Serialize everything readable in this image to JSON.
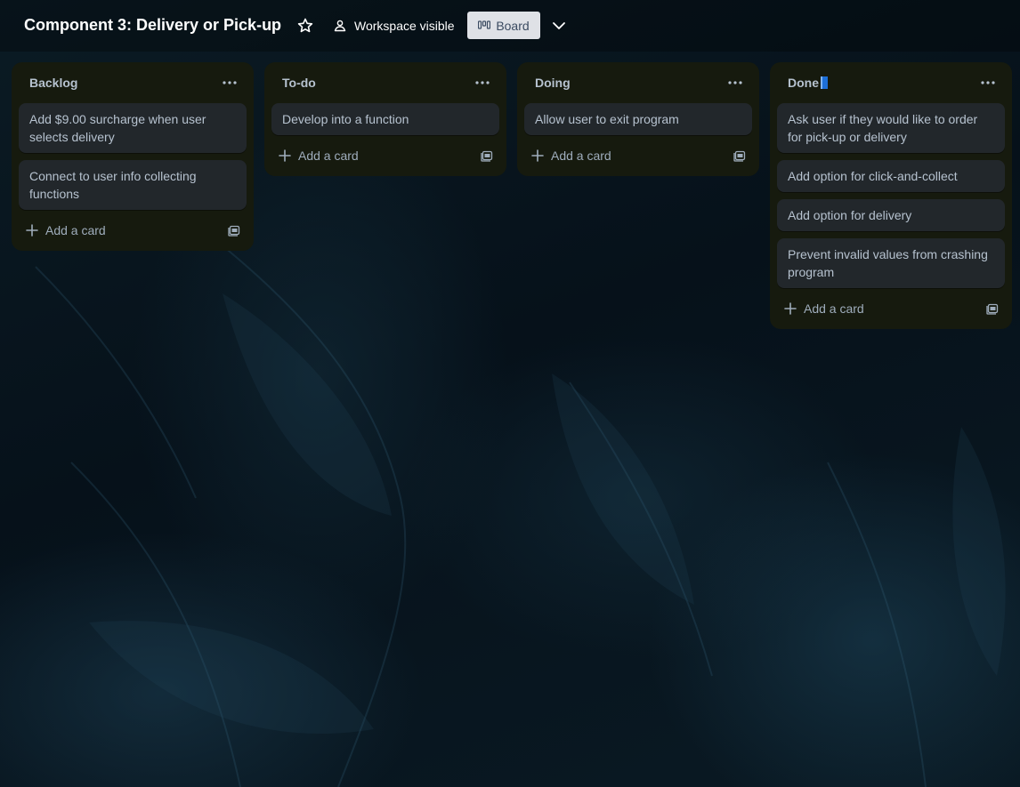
{
  "board": {
    "title": "Component 3: Delivery or Pick-up",
    "visibility_label": "Workspace visible",
    "view_label": "Board"
  },
  "lists": [
    {
      "title": "Backlog",
      "cards": [
        "Add $9.00 surcharge when user selects delivery",
        "Connect to user info collecting functions"
      ],
      "add_card_label": "Add a card"
    },
    {
      "title": "To-do",
      "cards": [
        "Develop into a function"
      ],
      "add_card_label": "Add a card"
    },
    {
      "title": "Doing",
      "cards": [
        "Allow user to exit program"
      ],
      "add_card_label": "Add a card"
    },
    {
      "title": "Done",
      "cards": [
        "Ask user if they would like to order for pick-up or delivery",
        "Add option for click-and-collect",
        "Add option for delivery",
        "Prevent invalid values from crashing program"
      ],
      "add_card_label": "Add a card"
    }
  ],
  "colors": {
    "list_background": "#161a0e",
    "card_background": "#22272b",
    "text": "#b6c2cf",
    "view_button_background": "#dfe1e6"
  }
}
